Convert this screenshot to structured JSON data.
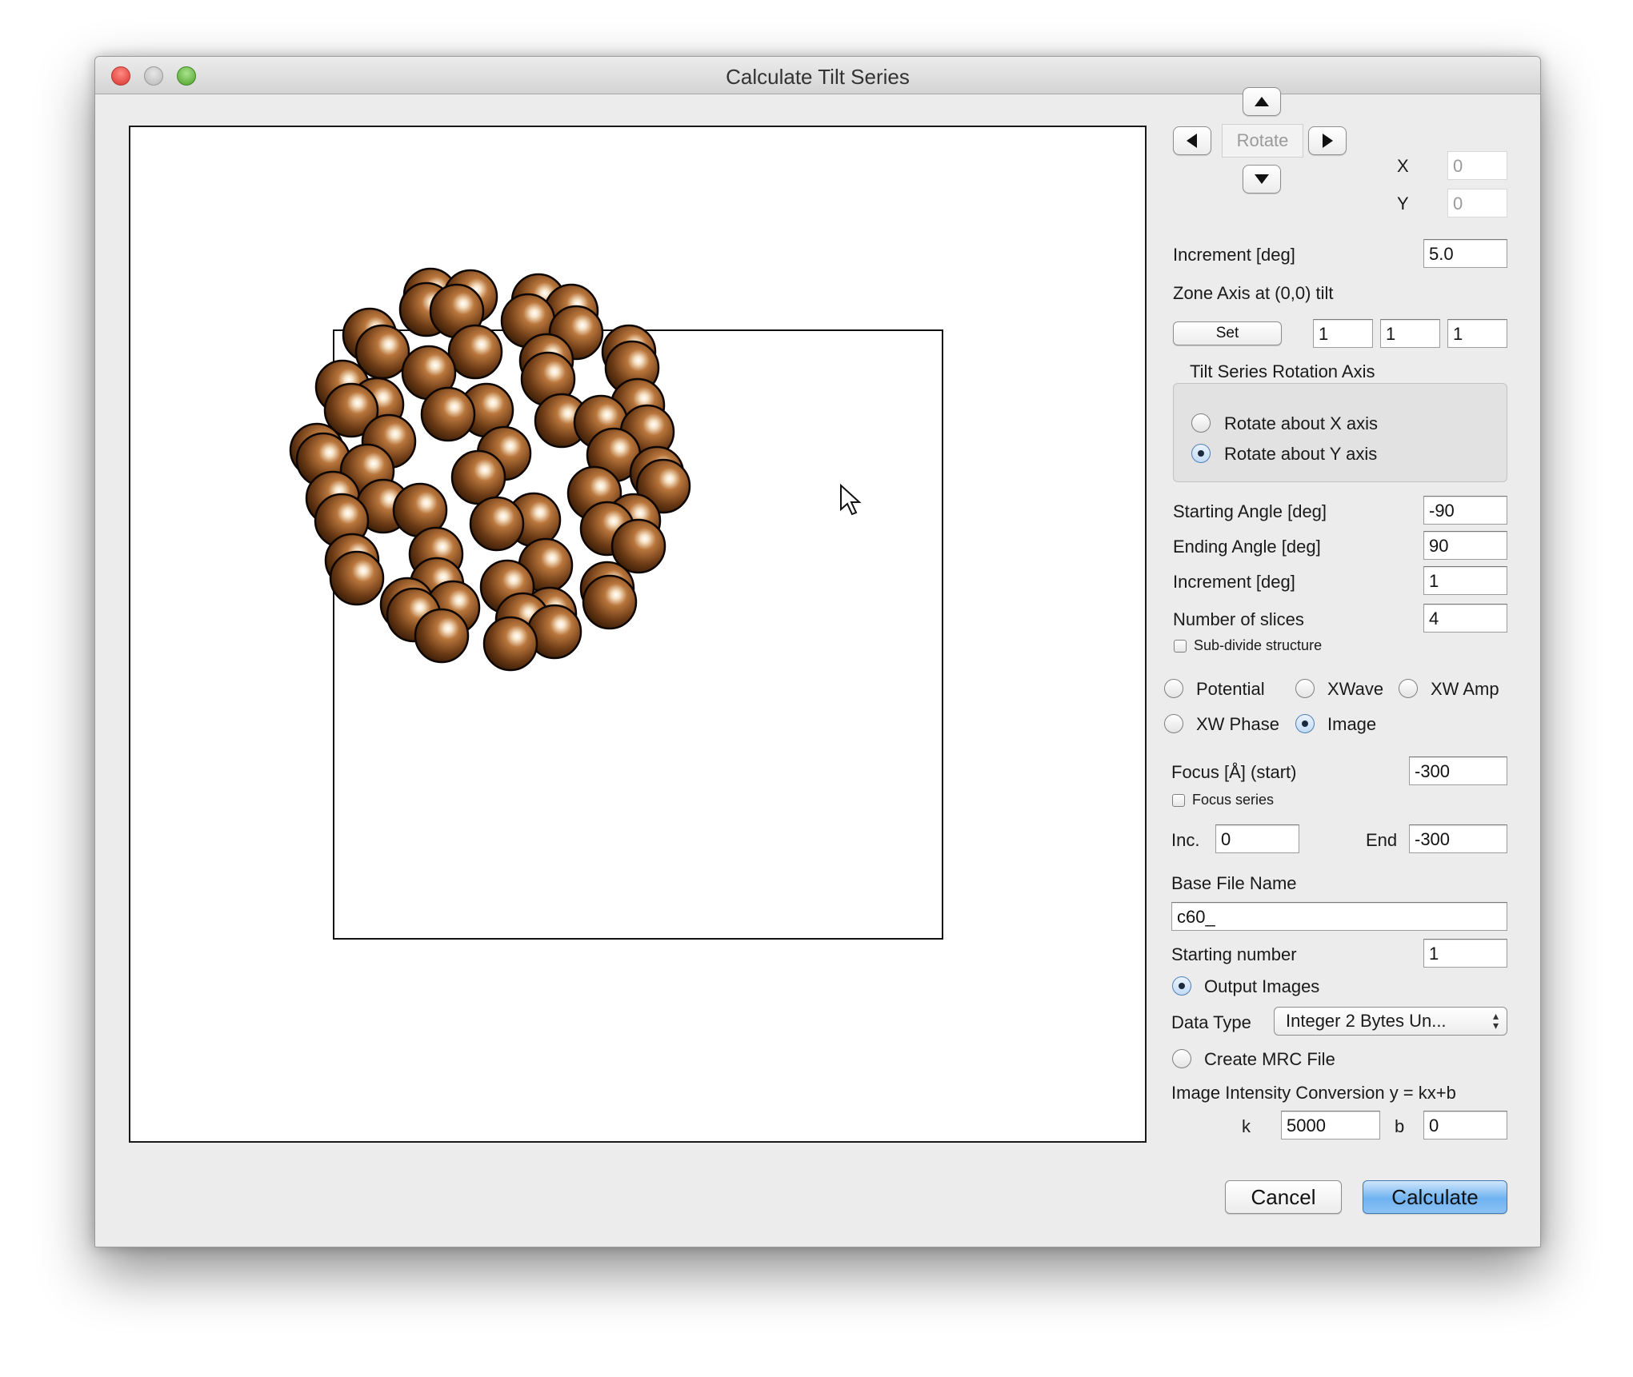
{
  "window": {
    "title": "Calculate Tilt Series"
  },
  "rotate": {
    "label": "Rotate",
    "x_label": "X",
    "x_value": "0",
    "y_label": "Y",
    "y_value": "0",
    "increment_label": "Increment [deg]",
    "increment_value": "5.0"
  },
  "zone_axis": {
    "label": "Zone Axis at (0,0) tilt",
    "set_label": "Set",
    "values": [
      "1",
      "1",
      "1"
    ]
  },
  "rotation_axis": {
    "group_label": "Tilt Series Rotation Axis",
    "options": [
      {
        "label": "Rotate about X axis",
        "selected": false
      },
      {
        "label": "Rotate about Y axis",
        "selected": true
      }
    ]
  },
  "series": {
    "start_label": "Starting Angle [deg]",
    "start_value": "-90",
    "end_label": "Ending Angle [deg]",
    "end_value": "90",
    "increment_label": "Increment [deg]",
    "increment_value": "1",
    "slices_label": "Number of slices",
    "slices_value": "4",
    "subdivide_label": "Sub-divide structure"
  },
  "output_type": {
    "options": [
      {
        "label": "Potential",
        "selected": false
      },
      {
        "label": "XWave",
        "selected": false
      },
      {
        "label": "XW Amp",
        "selected": false
      },
      {
        "label": "XW Phase",
        "selected": false
      },
      {
        "label": "Image",
        "selected": true
      }
    ]
  },
  "focus": {
    "start_label": "Focus [Å] (start)",
    "start_value": "-300",
    "series_label": "Focus series",
    "inc_label": "Inc.",
    "inc_value": "0",
    "end_label": "End",
    "end_value": "-300"
  },
  "file": {
    "base_label": "Base File Name",
    "base_value": "c60_",
    "start_num_label": "Starting number",
    "start_num_value": "1",
    "output_images_label": "Output Images",
    "data_type_label": "Data Type",
    "data_type_value": "Integer 2 Bytes Un...",
    "mrc_label": "Create MRC File",
    "conversion_label": "Image Intensity Conversion y = kx+b",
    "k_label": "k",
    "k_value": "5000",
    "b_label": "b",
    "b_value": "0"
  },
  "actions": {
    "cancel_label": "Cancel",
    "calculate_label": "Calculate"
  },
  "colors": {
    "atom": "#7a4a22",
    "atom_highlight": "#fff3dc",
    "accent": "#6fb2f1"
  },
  "icons": [
    "arrow-up-icon",
    "arrow-left-icon",
    "arrow-right-icon",
    "arrow-down-icon",
    "mouse-cursor-icon"
  ]
}
